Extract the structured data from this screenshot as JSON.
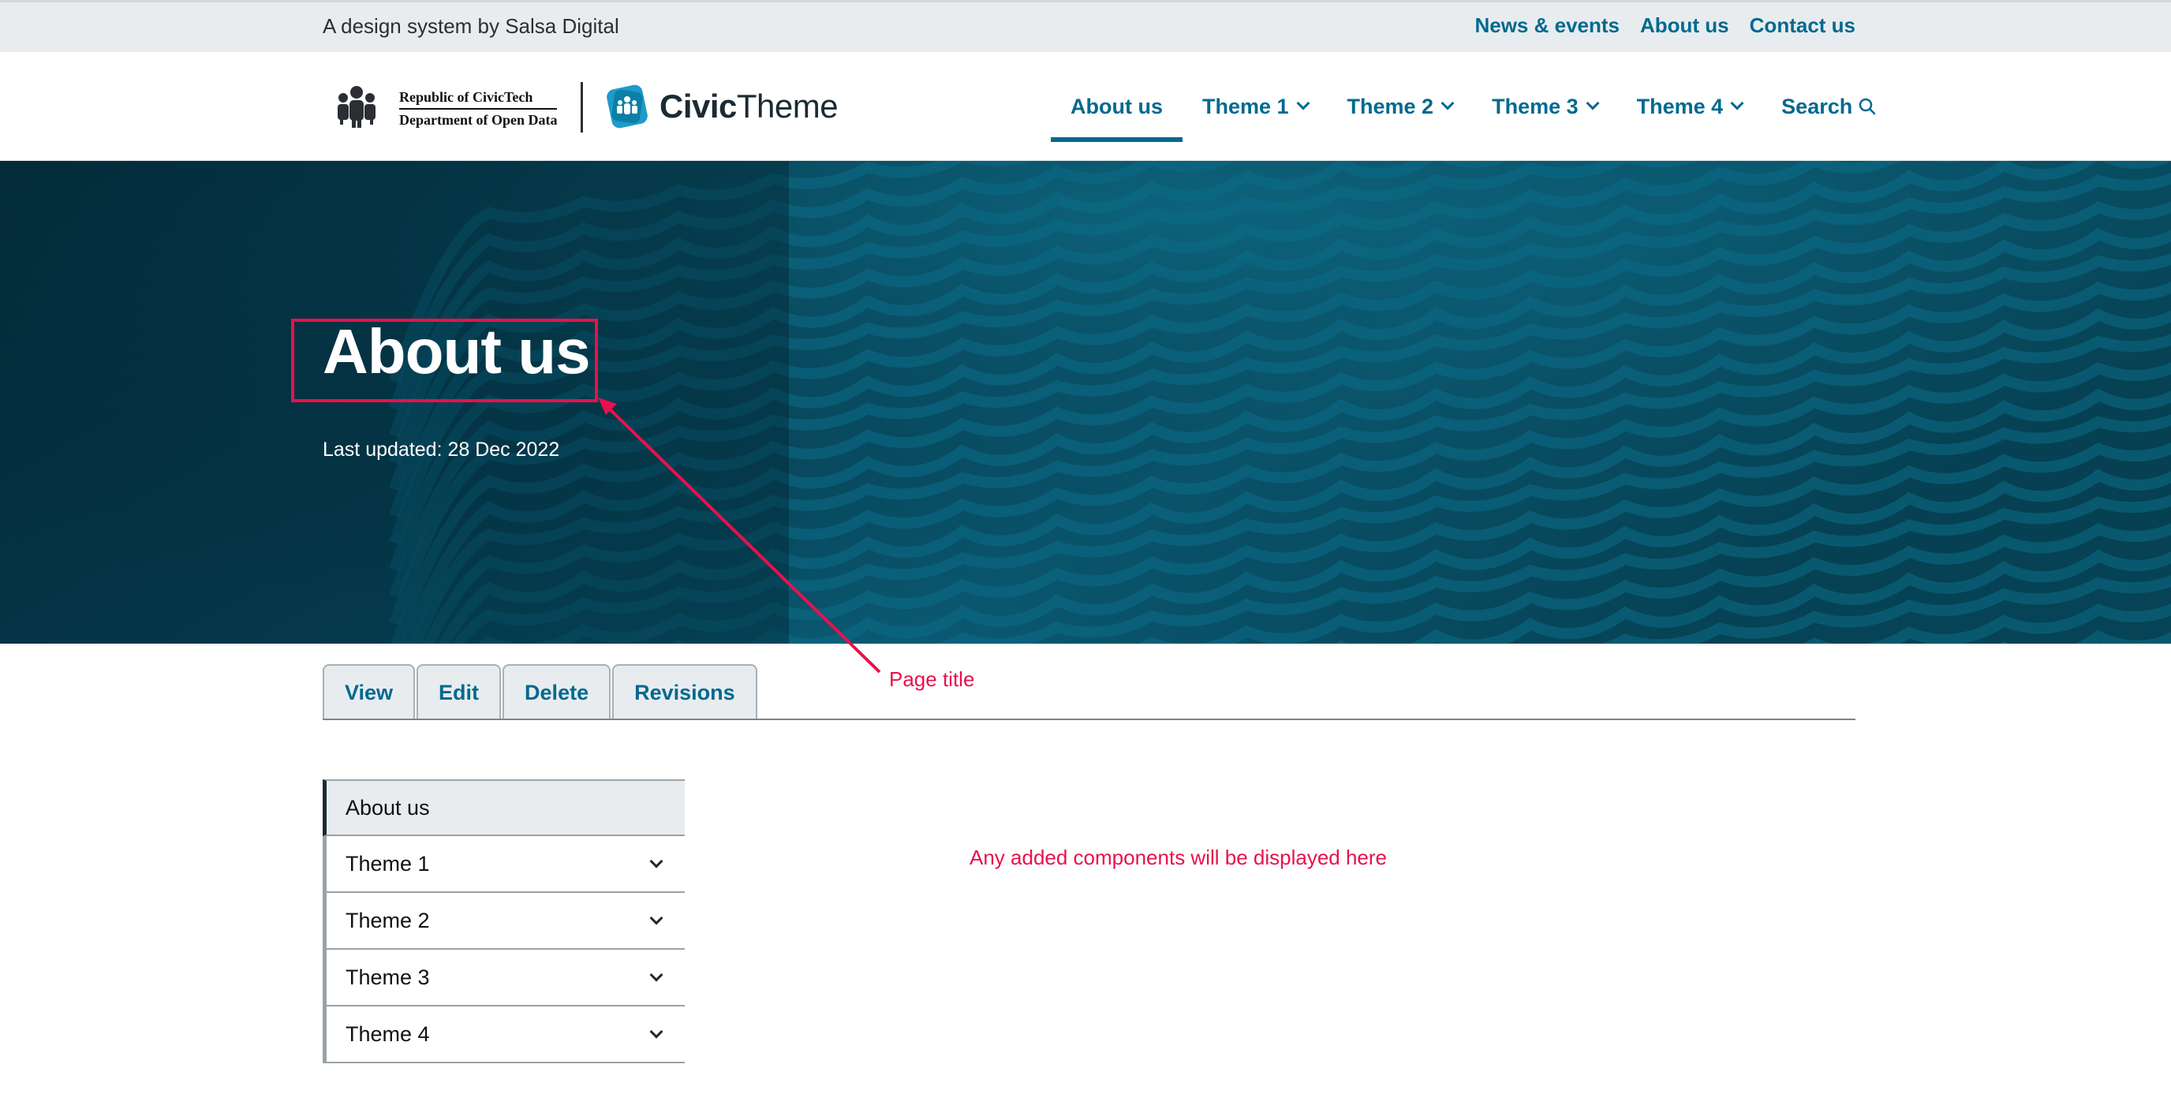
{
  "topbar": {
    "tagline": "A design system by Salsa Digital",
    "links": [
      "News & events",
      "About us",
      "Contact us"
    ]
  },
  "header": {
    "gov_line1": "Republic of CivicTech",
    "gov_line2": "Department of Open Data",
    "brand_bold": "Civic",
    "brand_regular": "Theme",
    "nav": [
      {
        "label": "About us",
        "active": true
      },
      {
        "label": "Theme 1"
      },
      {
        "label": "Theme 2"
      },
      {
        "label": "Theme 3"
      },
      {
        "label": "Theme 4"
      },
      {
        "label": "Search"
      }
    ]
  },
  "hero": {
    "title": "About us",
    "updated": "Last updated: 28 Dec 2022"
  },
  "annotations": {
    "page_title": "Page title",
    "components_note": "Any added components will be displayed here"
  },
  "tabs": [
    "View",
    "Edit",
    "Delete",
    "Revisions"
  ],
  "sidenav": [
    {
      "label": "About us",
      "active": true
    },
    {
      "label": "Theme 1"
    },
    {
      "label": "Theme 2"
    },
    {
      "label": "Theme 3"
    },
    {
      "label": "Theme 4"
    }
  ],
  "colors": {
    "accent": "#00698f",
    "hero_bg": "#06384a",
    "annotation": "#e8114d",
    "topbar_bg": "#e8ecef"
  }
}
